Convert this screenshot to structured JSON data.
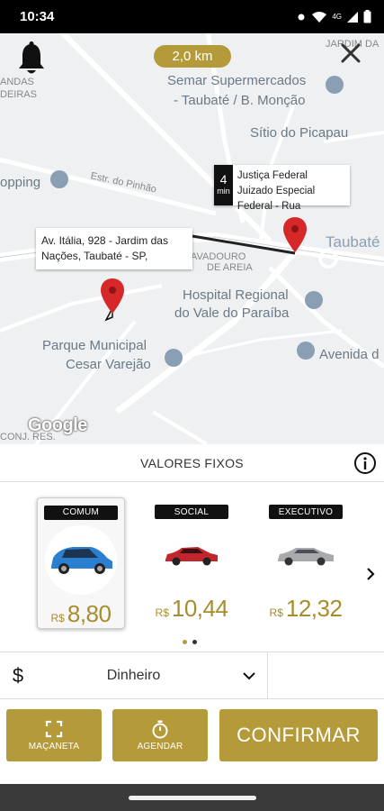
{
  "status_bar": {
    "time": "10:34",
    "network": "4G"
  },
  "map": {
    "distance": "2,0 km",
    "labels": {
      "semar_1": "Semar Supermercados",
      "semar_2": "- Taubaté / B. Monção",
      "sitio": "Sítio do Picapau",
      "shopping": "opping",
      "estr_pinhao": "Estr. do Pinhão",
      "taubate": "Taubaté",
      "hospital_1": "Hospital Regional",
      "hospital_2": "do Vale do Paraíba",
      "parque_1": "Parque Municipal",
      "parque_2": "Cesar Varejão",
      "avenida": "Avenida d",
      "jardim": "JARDIM DA",
      "areia": "DE AREIA",
      "avadouro": "AVADOURO",
      "deiras": "DEIRAS",
      "mas": "ANDAS",
      "conj": "CONJ. RES."
    },
    "origin_address": "Av. Itália, 928 - Jardim das Nações, Taubaté - SP,",
    "destination": {
      "eta_value": "4",
      "eta_unit": "min",
      "text": "Justiça Federal Juizado Especial Federal - Rua"
    },
    "attribution": "Google"
  },
  "section_title": "VALORES FIXOS",
  "cars": [
    {
      "tag": "COMUM",
      "currency": "R$",
      "price": "8,80",
      "color": "#2a7fd1",
      "selected": true
    },
    {
      "tag": "SOCIAL",
      "currency": "R$",
      "price": "10,44",
      "color": "#c0272d",
      "selected": false
    },
    {
      "tag": "EXECUTIVO",
      "currency": "R$",
      "price": "12,32",
      "color": "#a9aaad",
      "selected": false
    }
  ],
  "carousel": {
    "page": 1,
    "pages": 2
  },
  "payment": {
    "symbol": "$",
    "method": "Dinheiro"
  },
  "actions": {
    "handle_label": "MAÇANETA",
    "schedule_label": "AGENDAR",
    "confirm_label": "CONFIRMAR"
  },
  "colors": {
    "accent": "#b59a3a",
    "price": "#a88d2f",
    "pin": "#d62828"
  }
}
